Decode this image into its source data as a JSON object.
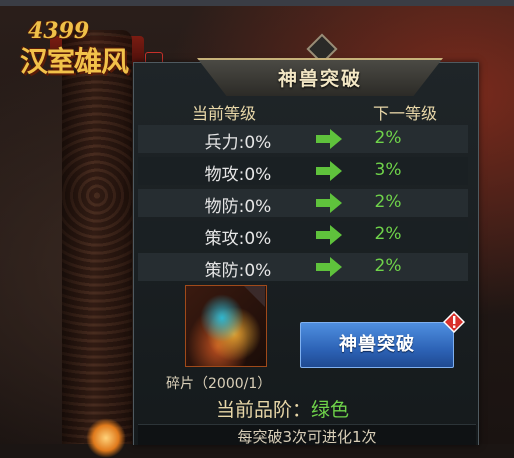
{
  "logo": {
    "number": "4399",
    "name": "汉室雄风"
  },
  "panel": {
    "title": "神兽突破",
    "current_level_header": "当前等级",
    "next_level_header": "下一等级",
    "rows": [
      {
        "current": "兵力:0%",
        "next": "2%"
      },
      {
        "current": "物攻:0%",
        "next": "3%"
      },
      {
        "current": "物防:0%",
        "next": "2%"
      },
      {
        "current": "策攻:0%",
        "next": "2%"
      },
      {
        "current": "策防:0%",
        "next": "2%"
      }
    ],
    "shard_label": "碎片（2000/1）",
    "breakthrough_button": "神兽突破",
    "grade_label": "当前品阶：",
    "grade_value": "绿色",
    "footer_note": "每突破3次可进化1次"
  },
  "colors": {
    "accent_green": "#6fd34a",
    "button_blue": "#2d63b6",
    "gold_text": "#e8d7a8"
  },
  "icons": [
    "green-arrow-right-icon",
    "alert-badge-icon",
    "beast-shard-card"
  ]
}
